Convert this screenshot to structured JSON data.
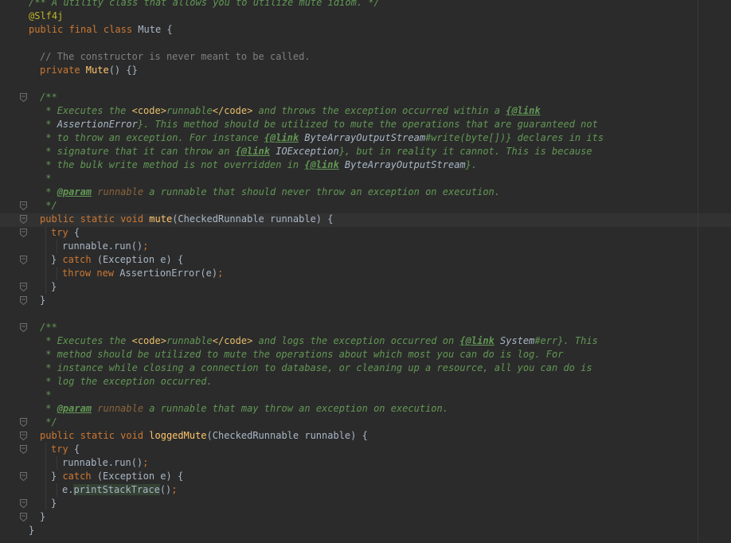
{
  "editor": {
    "lines": [
      {
        "id": "l01",
        "indent": 36,
        "fold": false,
        "tokens": [
          {
            "c": "doc",
            "t": "/** A utility class that allows you to utilize mute idiom. */"
          }
        ]
      },
      {
        "id": "l02",
        "indent": 36,
        "fold": false,
        "tokens": [
          {
            "c": "ann",
            "t": "@Slf4j"
          }
        ]
      },
      {
        "id": "l03",
        "indent": 36,
        "fold": false,
        "tokens": [
          {
            "c": "kw",
            "t": "public final class "
          },
          {
            "c": "plain",
            "t": "Mute {"
          }
        ]
      },
      {
        "id": "l04",
        "indent": 36,
        "fold": false,
        "tokens": []
      },
      {
        "id": "l05",
        "indent": 50,
        "fold": false,
        "tokens": [
          {
            "c": "cmt",
            "t": "// The constructor is never meant to be called."
          }
        ]
      },
      {
        "id": "l06",
        "indent": 50,
        "fold": false,
        "tokens": [
          {
            "c": "kw",
            "t": "private "
          },
          {
            "c": "fn",
            "t": "Mute"
          },
          {
            "c": "plain",
            "t": "() {}"
          }
        ]
      },
      {
        "id": "l07",
        "indent": 50,
        "fold": false,
        "tokens": []
      },
      {
        "id": "l08",
        "indent": 50,
        "fold": true,
        "tokens": [
          {
            "c": "doc",
            "t": "/**"
          }
        ]
      },
      {
        "id": "l09",
        "indent": 50,
        "fold": false,
        "tokens": [
          {
            "c": "doc",
            "t": " * Executes the "
          },
          {
            "c": "docmarkup",
            "t": "<code>"
          },
          {
            "c": "doc",
            "t": "runnable"
          },
          {
            "c": "docmarkup",
            "t": "</code>"
          },
          {
            "c": "doc",
            "t": " and throws the exception occurred within a "
          },
          {
            "c": "doctag",
            "t": "{@link"
          }
        ]
      },
      {
        "id": "l10",
        "indent": 50,
        "fold": false,
        "tokens": [
          {
            "c": "doc",
            "t": " * "
          },
          {
            "c": "docref",
            "t": "AssertionError"
          },
          {
            "c": "doc",
            "t": "}. This method should be utilized to mute the operations that are guaranteed not"
          }
        ]
      },
      {
        "id": "l11",
        "indent": 50,
        "fold": false,
        "tokens": [
          {
            "c": "doc",
            "t": " * to throw an exception. For instance "
          },
          {
            "c": "doctag",
            "t": "{@link"
          },
          {
            "c": "docref",
            "t": " ByteArrayOutputStream"
          },
          {
            "c": "doc",
            "t": "#write(byte[])}"
          },
          {
            "c": "doc",
            "t": " declares in its"
          }
        ]
      },
      {
        "id": "l12",
        "indent": 50,
        "fold": false,
        "tokens": [
          {
            "c": "doc",
            "t": " * signature that it can throw an "
          },
          {
            "c": "doctag",
            "t": "{@link"
          },
          {
            "c": "docref",
            "t": " IOException"
          },
          {
            "c": "doc",
            "t": "}, but in reality it cannot. This is because"
          }
        ]
      },
      {
        "id": "l13",
        "indent": 50,
        "fold": false,
        "tokens": [
          {
            "c": "doc",
            "t": " * the bulk write method is not overridden in "
          },
          {
            "c": "doctag",
            "t": "{@link"
          },
          {
            "c": "docref",
            "t": " ByteArrayOutputStream"
          },
          {
            "c": "doc",
            "t": "}."
          }
        ]
      },
      {
        "id": "l14",
        "indent": 50,
        "fold": false,
        "tokens": [
          {
            "c": "doc",
            "t": " *"
          }
        ]
      },
      {
        "id": "l15",
        "indent": 50,
        "fold": false,
        "tokens": [
          {
            "c": "doc",
            "t": " * "
          },
          {
            "c": "doctag",
            "t": "@param"
          },
          {
            "c": "docparamname",
            "t": " runnable"
          },
          {
            "c": "doc",
            "t": " a runnable that should never throw an exception on execution."
          }
        ]
      },
      {
        "id": "l16",
        "indent": 50,
        "fold": true,
        "tokens": [
          {
            "c": "doc",
            "t": " */"
          }
        ]
      },
      {
        "id": "l17",
        "indent": 50,
        "fold": true,
        "tokens": [
          {
            "c": "kw",
            "t": "public static void "
          },
          {
            "c": "fn",
            "t": "mute"
          },
          {
            "c": "plain",
            "t": "(CheckedRunnable runnable) {"
          }
        ]
      },
      {
        "id": "l18",
        "indent": 64,
        "fold": true,
        "tokens": [
          {
            "c": "kw",
            "t": "try "
          },
          {
            "c": "plain",
            "t": "{"
          }
        ]
      },
      {
        "id": "l19",
        "indent": 78,
        "fold": false,
        "tokens": [
          {
            "c": "plain",
            "t": "runnable.run()"
          },
          {
            "c": "kw",
            "t": ";"
          }
        ]
      },
      {
        "id": "l20",
        "indent": 64,
        "fold": true,
        "tokens": [
          {
            "c": "plain",
            "t": "} "
          },
          {
            "c": "kw",
            "t": "catch "
          },
          {
            "c": "plain",
            "t": "(Exception e) {"
          }
        ]
      },
      {
        "id": "l21",
        "indent": 78,
        "fold": false,
        "tokens": [
          {
            "c": "kw",
            "t": "throw new "
          },
          {
            "c": "plain",
            "t": "AssertionError(e)"
          },
          {
            "c": "kw",
            "t": ";"
          }
        ]
      },
      {
        "id": "l22",
        "indent": 64,
        "fold": true,
        "tokens": [
          {
            "c": "plain",
            "t": "}"
          }
        ]
      },
      {
        "id": "l23",
        "indent": 50,
        "fold": true,
        "tokens": [
          {
            "c": "plain",
            "t": "}"
          }
        ]
      },
      {
        "id": "l24",
        "indent": 50,
        "fold": false,
        "tokens": []
      },
      {
        "id": "l25",
        "indent": 50,
        "fold": true,
        "tokens": [
          {
            "c": "doc",
            "t": "/**"
          }
        ]
      },
      {
        "id": "l26",
        "indent": 50,
        "fold": false,
        "tokens": [
          {
            "c": "doc",
            "t": " * Executes the "
          },
          {
            "c": "docmarkup",
            "t": "<code>"
          },
          {
            "c": "doc",
            "t": "runnable"
          },
          {
            "c": "docmarkup",
            "t": "</code>"
          },
          {
            "c": "doc",
            "t": " and logs the exception occurred on "
          },
          {
            "c": "doctag",
            "t": "{@link"
          },
          {
            "c": "docref",
            "t": " System"
          },
          {
            "c": "doc",
            "t": "#err}. This"
          }
        ]
      },
      {
        "id": "l27",
        "indent": 50,
        "fold": false,
        "tokens": [
          {
            "c": "doc",
            "t": " * method should be utilized to mute the operations about which most you can do is log. For"
          }
        ]
      },
      {
        "id": "l28",
        "indent": 50,
        "fold": false,
        "tokens": [
          {
            "c": "doc",
            "t": " * instance while closing a connection to database, or cleaning up a resource, all you can do is"
          }
        ]
      },
      {
        "id": "l29",
        "indent": 50,
        "fold": false,
        "tokens": [
          {
            "c": "doc",
            "t": " * log the exception occurred."
          }
        ]
      },
      {
        "id": "l30",
        "indent": 50,
        "fold": false,
        "tokens": [
          {
            "c": "doc",
            "t": " *"
          }
        ]
      },
      {
        "id": "l31",
        "indent": 50,
        "fold": false,
        "tokens": [
          {
            "c": "doc",
            "t": " * "
          },
          {
            "c": "doctag",
            "t": "@param"
          },
          {
            "c": "docparamname",
            "t": " runnable"
          },
          {
            "c": "doc",
            "t": " a runnable that may throw an exception on execution."
          }
        ]
      },
      {
        "id": "l32",
        "indent": 50,
        "fold": true,
        "tokens": [
          {
            "c": "doc",
            "t": " */"
          }
        ]
      },
      {
        "id": "l33",
        "indent": 50,
        "fold": true,
        "tokens": [
          {
            "c": "kw",
            "t": "public static void "
          },
          {
            "c": "fn",
            "t": "loggedMute"
          },
          {
            "c": "plain",
            "t": "(CheckedRunnable runnable) {"
          }
        ]
      },
      {
        "id": "l34",
        "indent": 64,
        "fold": true,
        "tokens": [
          {
            "c": "kw",
            "t": "try "
          },
          {
            "c": "plain",
            "t": "{"
          }
        ]
      },
      {
        "id": "l35",
        "indent": 78,
        "fold": false,
        "tokens": [
          {
            "c": "plain",
            "t": "runnable.run()"
          },
          {
            "c": "kw",
            "t": ";"
          }
        ]
      },
      {
        "id": "l36",
        "indent": 64,
        "fold": true,
        "tokens": [
          {
            "c": "plain",
            "t": "} "
          },
          {
            "c": "kw",
            "t": "catch "
          },
          {
            "c": "plain",
            "t": "(Exception e) {"
          }
        ]
      },
      {
        "id": "l37",
        "indent": 78,
        "fold": false,
        "tokens": [
          {
            "c": "plain",
            "t": "e."
          },
          {
            "c": "plain hl",
            "t": "printStackTrace"
          },
          {
            "c": "plain",
            "t": "()"
          },
          {
            "c": "kw",
            "t": ";"
          }
        ]
      },
      {
        "id": "l38",
        "indent": 64,
        "fold": true,
        "tokens": [
          {
            "c": "plain",
            "t": "}"
          }
        ]
      },
      {
        "id": "l39",
        "indent": 50,
        "fold": true,
        "tokens": [
          {
            "c": "plain",
            "t": "}"
          }
        ]
      },
      {
        "id": "l40",
        "indent": 36,
        "fold": false,
        "tokens": [
          {
            "c": "plain",
            "t": "}"
          }
        ]
      }
    ]
  },
  "colors": {
    "background": "#2b2b2b",
    "keyword": "#cc7832",
    "function": "#ffc66d",
    "annotation": "#bbb529",
    "comment": "#808080",
    "doc": "#629755",
    "text": "#a9b7c6"
  },
  "icons": {
    "fold": "fold-marker-icon"
  }
}
